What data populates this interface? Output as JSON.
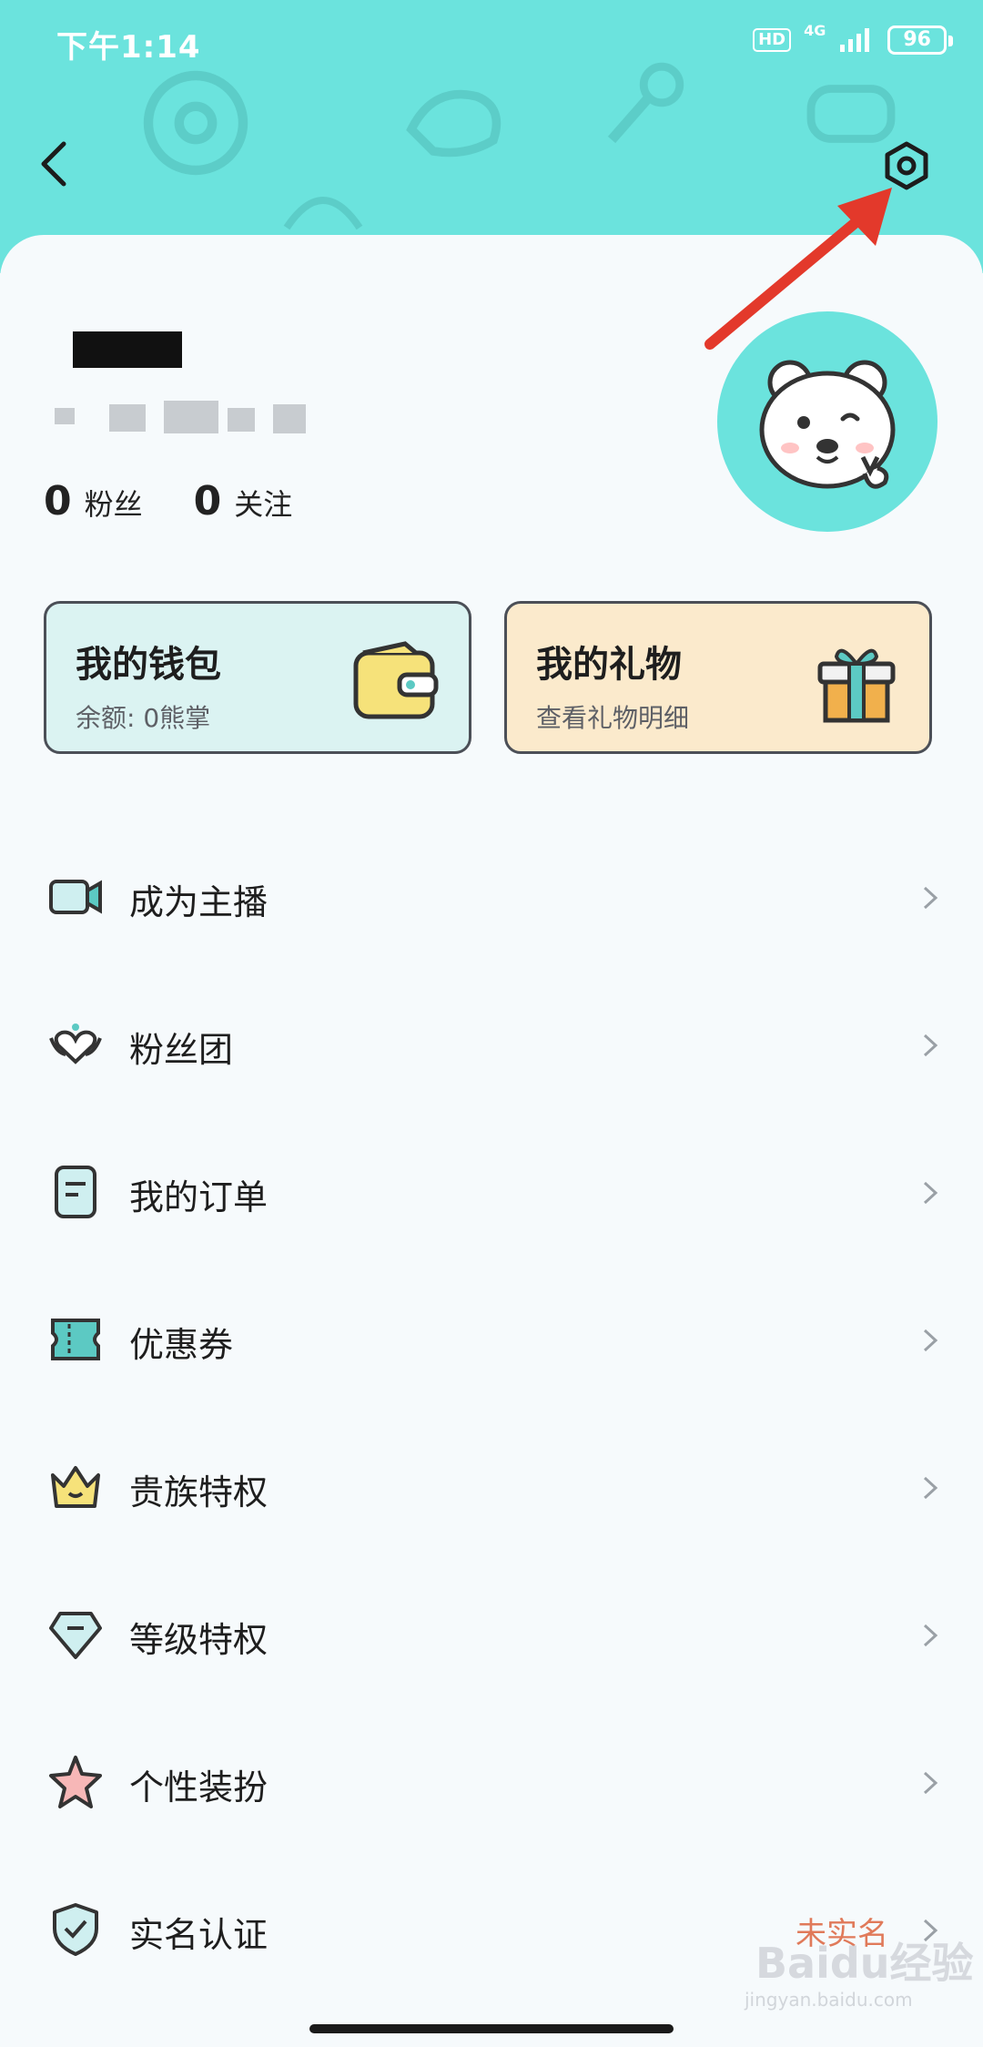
{
  "status_bar": {
    "time": "下午1:14",
    "hd": "HD",
    "network": "4G",
    "battery": "96"
  },
  "profile": {
    "fans_count": "0",
    "fans_label": "粉丝",
    "follow_count": "0",
    "follow_label": "关注"
  },
  "cards": {
    "wallet": {
      "title": "我的钱包",
      "subtitle": "余额: 0熊掌"
    },
    "gift": {
      "title": "我的礼物",
      "subtitle": "查看礼物明细"
    }
  },
  "menu": [
    {
      "label": "成为主播",
      "icon": "camera-icon",
      "extra": ""
    },
    {
      "label": "粉丝团",
      "icon": "fan-group-icon",
      "extra": ""
    },
    {
      "label": "我的订单",
      "icon": "order-icon",
      "extra": ""
    },
    {
      "label": "优惠券",
      "icon": "coupon-icon",
      "extra": ""
    },
    {
      "label": "贵族特权",
      "icon": "crown-icon",
      "extra": ""
    },
    {
      "label": "等级特权",
      "icon": "diamond-icon",
      "extra": ""
    },
    {
      "label": "个性装扮",
      "icon": "star-icon",
      "extra": ""
    },
    {
      "label": "实名认证",
      "icon": "shield-icon",
      "extra": "未实名"
    }
  ],
  "watermark": {
    "text": "Baidu经验",
    "sub": "jingyan.baidu.com"
  },
  "colors": {
    "accent": "#6be3dd",
    "warning_text": "#e07a5a"
  }
}
